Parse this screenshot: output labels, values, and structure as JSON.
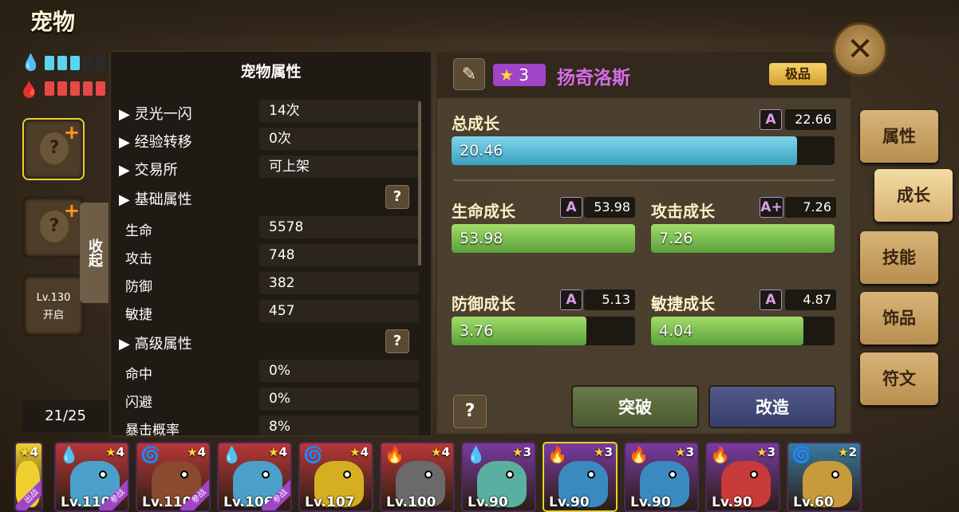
{
  "header": {
    "title": "宠物"
  },
  "resources": {
    "water_icon": "water-drop-icon",
    "fire_icon": "fire-drop-icon",
    "water_color": "#5ad4f0",
    "fire_color": "#e84848"
  },
  "left_slots": {
    "slot3_level": "Lv.130",
    "slot3_status": "开启",
    "collapse_label": "收起",
    "pet_count": "21/25"
  },
  "attributes": {
    "title": "宠物属性",
    "rows": [
      {
        "label": "▶ 灵光一闪",
        "value": "14次"
      },
      {
        "label": "▶ 经验转移",
        "value": "0次"
      },
      {
        "label": "▶ 交易所",
        "value": "可上架"
      }
    ],
    "basic_header": "▶ 基础属性",
    "basic": [
      {
        "label": "生命",
        "value": "5578"
      },
      {
        "label": "攻击",
        "value": "748"
      },
      {
        "label": "防御",
        "value": "382"
      },
      {
        "label": "敏捷",
        "value": "457"
      }
    ],
    "advanced_header": "▶ 高级属性",
    "advanced": [
      {
        "label": "命中",
        "value": "0%"
      },
      {
        "label": "闪避",
        "value": "0%"
      },
      {
        "label": "暴击概率",
        "value": "8%"
      }
    ],
    "help_label": "?"
  },
  "pet": {
    "star_count": "3",
    "name": "扬奇洛斯",
    "quality": "极品"
  },
  "growth": {
    "total": {
      "label": "总成长",
      "grade": "A",
      "max": "22.66",
      "value": "20.46",
      "fraction": 0.903
    },
    "hp": {
      "label": "生命成长",
      "grade": "A",
      "max": "53.98",
      "value": "53.98",
      "fraction": 1.0
    },
    "atk": {
      "label": "攻击成长",
      "grade": "A+",
      "max": "7.26",
      "value": "7.26",
      "fraction": 1.0
    },
    "def": {
      "label": "防御成长",
      "grade": "A",
      "max": "5.13",
      "value": "3.76",
      "fraction": 0.733
    },
    "agi": {
      "label": "敏捷成长",
      "grade": "A",
      "max": "4.87",
      "value": "4.04",
      "fraction": 0.83
    }
  },
  "actions": {
    "help": "?",
    "breakthrough": "突破",
    "reform": "改造"
  },
  "close_icon": "close-icon",
  "side_tabs": [
    {
      "label": "属性",
      "active": false
    },
    {
      "label": "成长",
      "active": true
    },
    {
      "label": "技能",
      "active": false
    },
    {
      "label": "饰品",
      "active": false
    },
    {
      "label": "符文",
      "active": false
    }
  ],
  "pet_list": [
    {
      "stars": "4",
      "level": "",
      "color": "#f0d030",
      "body": "#f0d030",
      "elem": "",
      "tag": "出战"
    },
    {
      "stars": "4",
      "level": "Lv.110",
      "color": "#b83838",
      "body": "#4aa0c8",
      "elem": "water-drop-icon",
      "tag": "参战"
    },
    {
      "stars": "4",
      "level": "Lv.110",
      "color": "#b83838",
      "body": "#8a4a30",
      "elem": "swirl-icon",
      "tag": "参战"
    },
    {
      "stars": "4",
      "level": "Lv.106",
      "color": "#b83838",
      "body": "#4aa0c8",
      "elem": "water-drop-icon",
      "tag": "参战"
    },
    {
      "stars": "4",
      "level": "Lv.107",
      "color": "#b83838",
      "body": "#d4b020",
      "elem": "swirl-icon",
      "tag": ""
    },
    {
      "stars": "4",
      "level": "Lv.100",
      "color": "#b83838",
      "body": "#6a6a6a",
      "elem": "fire-drop-icon",
      "tag": ""
    },
    {
      "stars": "3",
      "level": "Lv.90",
      "color": "#7a3aa0",
      "body": "#5ab0a0",
      "elem": "water-drop-icon",
      "tag": ""
    },
    {
      "stars": "3",
      "level": "Lv.90",
      "color": "#7a3aa0",
      "body": "#3a8ac0",
      "elem": "fire-drop-icon",
      "tag": ""
    },
    {
      "stars": "3",
      "level": "Lv.90",
      "color": "#7a3aa0",
      "body": "#3a8ac0",
      "elem": "fire-drop-icon",
      "tag": ""
    },
    {
      "stars": "3",
      "level": "Lv.90",
      "color": "#7a3aa0",
      "body": "#c83a3a",
      "elem": "fire-drop-icon",
      "tag": ""
    },
    {
      "stars": "2",
      "level": "Lv.60",
      "color": "#3a7aa0",
      "body": "#c89a3a",
      "elem": "swirl-icon",
      "tag": ""
    }
  ]
}
